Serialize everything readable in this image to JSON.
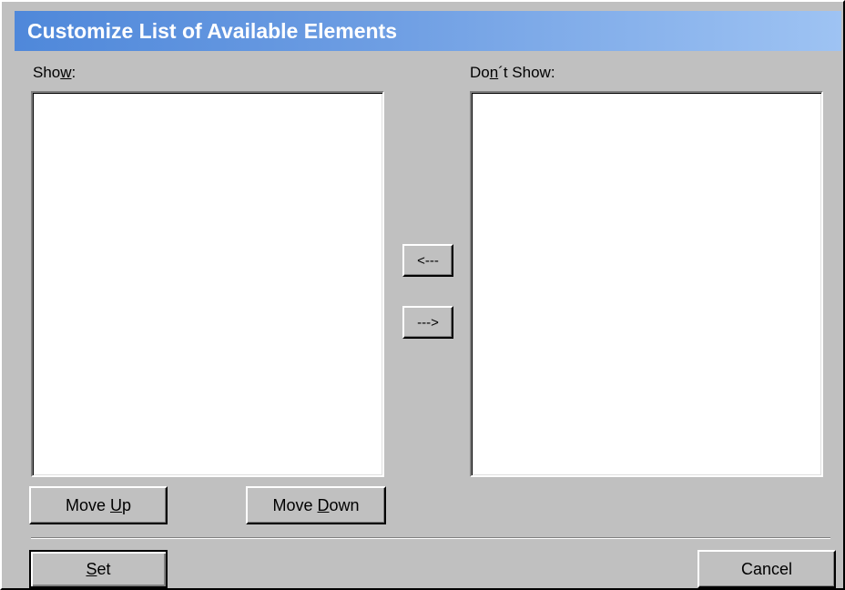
{
  "dialog": {
    "title": "Customize List of Available Elements"
  },
  "show_panel": {
    "label_before": "Sho",
    "label_mnemonic": "w",
    "label_after": ":",
    "items": []
  },
  "dont_show_panel": {
    "label_before": "Do",
    "label_mnemonic": "n",
    "label_after": "´t Show:",
    "items": []
  },
  "transfer": {
    "move_left_label": "<---",
    "move_right_label": "--->"
  },
  "ordering": {
    "move_up_before": "Move ",
    "move_up_mnemonic": "U",
    "move_up_after": "p",
    "move_down_before": "Move ",
    "move_down_mnemonic": "D",
    "move_down_after": "own"
  },
  "footer": {
    "set_mnemonic": "S",
    "set_after": "et",
    "cancel_label": "Cancel"
  },
  "colors": {
    "face": "#c0c0c0",
    "title_start": "#4f88da",
    "title_end": "#9ec3f3",
    "list_bg": "#ffffff"
  }
}
